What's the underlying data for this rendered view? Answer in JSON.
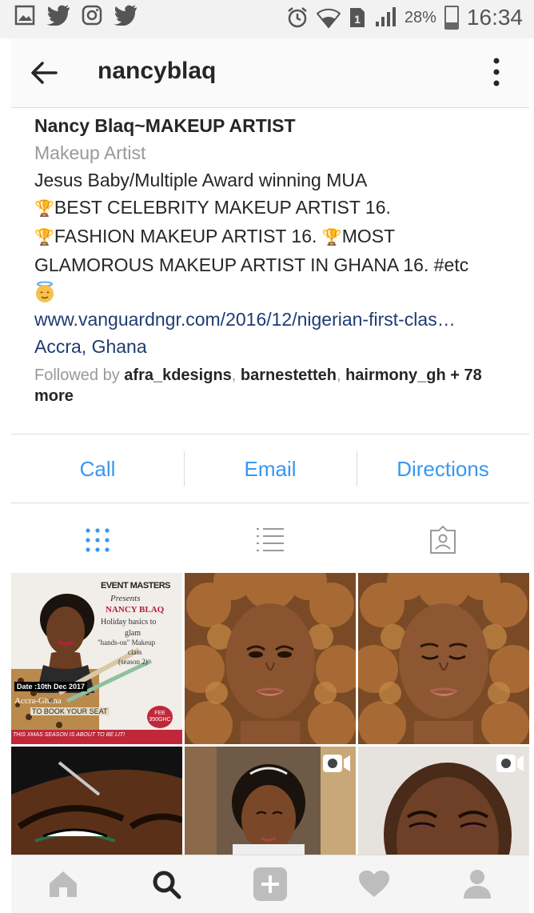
{
  "status_bar": {
    "battery": "28%",
    "time": "16:34"
  },
  "header": {
    "username": "nancyblaq"
  },
  "profile": {
    "name": "Nancy Blaq~MAKEUP ARTIST",
    "category": "Makeup Artist",
    "bio_line1": "Jesus Baby/Multiple Award winning MUA",
    "bio_line2": "BEST CELEBRITY MAKEUP ARTIST 16.",
    "bio_line3a": "FASHION MAKEUP ARTIST 16.",
    "bio_line3b": "MOST",
    "bio_line4": "GLAMOROUS MAKEUP ARTIST IN GHANA 16. #etc",
    "link": "www.vanguardngr.com/2016/12/nigerian-first-clas…",
    "location": "Accra, Ghana",
    "followed_prefix": "Followed by",
    "followers": [
      "afra_kdesigns",
      "barnestetteh",
      "hairmony_gh"
    ],
    "followed_more": "+ 78 more"
  },
  "actions": {
    "call": "Call",
    "email": "Email",
    "directions": "Directions"
  },
  "post1": {
    "brand": "EVENT MASTERS",
    "presents": "Presents",
    "name": "NANCY BLAQ",
    "line1": "Holiday basics to",
    "line2": "glam",
    "line3": "\"hands-on\" Makeup",
    "line4": "class",
    "line5": "(season 2)",
    "date": "Date :10th Dec 2017",
    "place": "Accra-Ghana",
    "book": "TO BOOK YOUR SEAT",
    "fee": "FEE 350GHC",
    "footer": "THIS XMAS SEASON IS ABOUT TO BE LIT!"
  },
  "colors": {
    "accent": "#3897f0",
    "link": "#1f3b72",
    "muted": "#999999"
  }
}
